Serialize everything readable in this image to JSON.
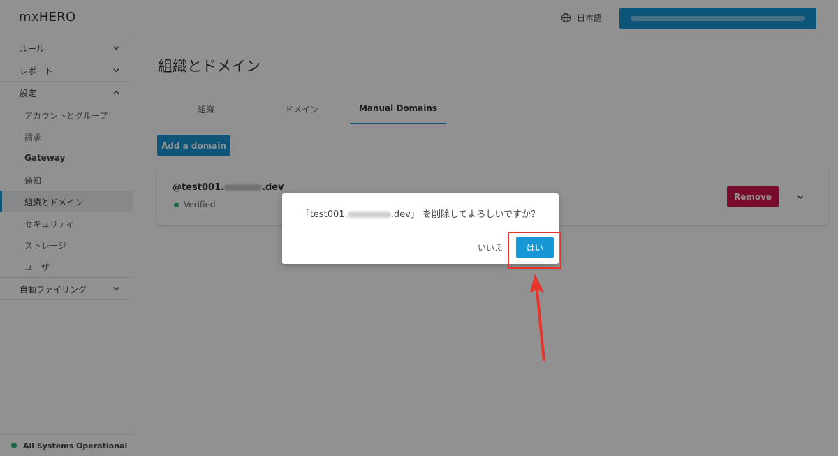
{
  "app": {
    "title": "mxHERO"
  },
  "header": {
    "language_label": "日本語",
    "globe_icon": "globe-icon"
  },
  "sidebar": {
    "sections": [
      {
        "label": "ルール",
        "expanded": false
      },
      {
        "label": "レポート",
        "expanded": false
      },
      {
        "label": "設定",
        "expanded": true
      }
    ],
    "settings_items": [
      {
        "label": "アカウントとグループ"
      },
      {
        "label": "請求"
      },
      {
        "label": "Gateway"
      },
      {
        "label": "通知"
      },
      {
        "label": "組織とドメイン",
        "active": true
      },
      {
        "label": "セキュリティ"
      },
      {
        "label": "ストレージ"
      },
      {
        "label": "ユーザー"
      }
    ],
    "auto_filing": {
      "label": "自動ファイリング"
    },
    "status": {
      "label": "All Systems Operational",
      "color": "#2bb673"
    }
  },
  "main": {
    "title": "組織とドメイン",
    "tabs": [
      {
        "label": "組織"
      },
      {
        "label": "ドメイン"
      },
      {
        "label": "Manual Domains",
        "active": true
      }
    ],
    "add_button": "Add a domain",
    "domain": {
      "name_prefix": "@test001.",
      "name_suffix": ".dev",
      "status": "Verified",
      "remove_button": "Remove"
    }
  },
  "dialog": {
    "message_prefix": "「test001.",
    "message_suffix": ".dev」 を削除してよろしいですか？",
    "no_button": "いいえ",
    "yes_button": "はい"
  },
  "colors": {
    "primary": "#1797d6",
    "danger": "#d3164f",
    "success": "#2bb673",
    "annotation": "#e8352b"
  }
}
